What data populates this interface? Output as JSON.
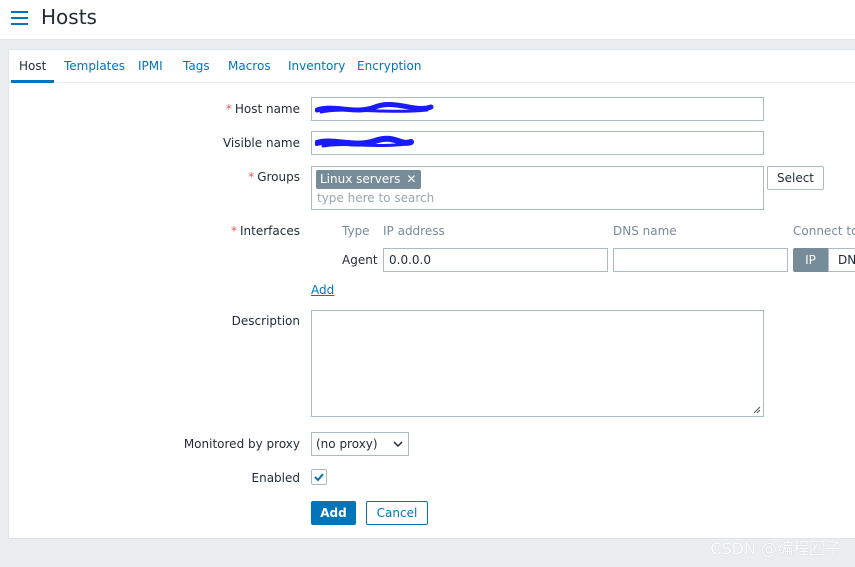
{
  "header": {
    "title": "Hosts",
    "menu_icon": "hamburger-menu-icon",
    "accent_color": "#0275b8"
  },
  "tabs": [
    {
      "label": "Host",
      "active": true
    },
    {
      "label": "Templates"
    },
    {
      "label": "IPMI"
    },
    {
      "label": "Tags"
    },
    {
      "label": "Macros"
    },
    {
      "label": "Inventory"
    },
    {
      "label": "Encryption"
    }
  ],
  "form": {
    "required_mark": "*",
    "host_name": {
      "label": "Host name",
      "value_state": "redacted with blue scribble"
    },
    "visible_name": {
      "label": "Visible name",
      "value_state": "redacted with blue scribble"
    },
    "groups": {
      "label": "Groups",
      "selected": [
        "Linux servers"
      ],
      "remove_glyph": "✕",
      "placeholder": "type here to search",
      "select_button": "Select"
    },
    "interfaces": {
      "label": "Interfaces",
      "columns": [
        "Type",
        "IP address",
        "DNS name",
        "Connect to"
      ],
      "rows": [
        {
          "type": "Agent",
          "ip": "0.0.0.0",
          "dns": "",
          "connect_ip": "IP",
          "connect_dns": "DNS",
          "connect_selected": "IP"
        }
      ],
      "add_link": "Add"
    },
    "description": {
      "label": "Description",
      "value": ""
    },
    "proxy": {
      "label": "Monitored by proxy",
      "value": "(no proxy)"
    },
    "enabled": {
      "label": "Enabled",
      "checked": true
    },
    "buttons": {
      "add": "Add",
      "cancel": "Cancel"
    }
  },
  "watermark": "CSDN @编程圈子"
}
